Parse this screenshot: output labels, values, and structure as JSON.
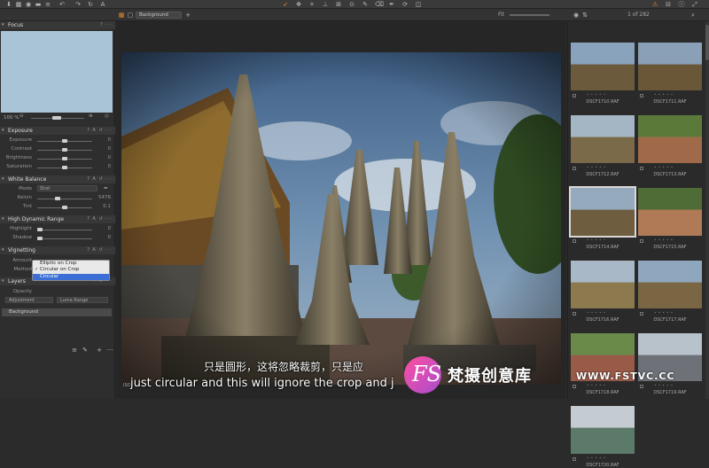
{
  "toolbar": {
    "left_icons": [
      "import-icon",
      "grid-icon",
      "camera-icon",
      "folder-icon",
      "undo-icon",
      "redo-icon",
      "redo-icon",
      "text-icon"
    ],
    "center_icons": [
      "cursor-icon",
      "move-icon",
      "crop-icon",
      "straighten-icon",
      "keystone-icon",
      "spot-icon",
      "brush-icon",
      "eraser-icon",
      "picker-icon",
      "rotate-icon",
      "gradient-icon"
    ],
    "right_icons": [
      "warning-icon",
      "compare-icon",
      "info-icon",
      "expand-icon"
    ]
  },
  "subbar": {
    "layer_select": "Background",
    "fit_label": "Fit",
    "counter": "1 of 282"
  },
  "left": {
    "focus": {
      "title": "Focus"
    },
    "zoom": {
      "value": "100 %"
    },
    "exposure": {
      "title": "Exposure",
      "rows": [
        {
          "label": "Exposure",
          "value": "0",
          "level": 0.5
        },
        {
          "label": "Contrast",
          "value": "0",
          "level": 0.5
        },
        {
          "label": "Brightness",
          "value": "0",
          "level": 0.5
        },
        {
          "label": "Saturation",
          "value": "0",
          "level": 0.5
        }
      ]
    },
    "white_balance": {
      "title": "White Balance",
      "mode_label": "Mode",
      "mode_value": "Shot",
      "rows": [
        {
          "label": "Kelvin",
          "value": "5476",
          "level": 0.35
        },
        {
          "label": "Tint",
          "value": "0.1",
          "level": 0.5
        }
      ]
    },
    "hdr": {
      "title": "High Dynamic Range",
      "rows": [
        {
          "label": "Highlight",
          "value": "0",
          "level": 0.0
        },
        {
          "label": "Shadow",
          "value": "0",
          "level": 0.0
        }
      ]
    },
    "vignetting": {
      "title": "Vignetting",
      "amount_label": "Amount",
      "method_label": "Method",
      "method_options": [
        "Elliptic on Crop",
        "Circular on Crop",
        "Circular"
      ],
      "selected_option": "Circular",
      "checked_option": "Circular on Crop"
    },
    "layers": {
      "title": "Layers",
      "opacity_label": "Opacity",
      "buttons": [
        "Adjustment",
        "Luma Range"
      ],
      "background_layer": "Background"
    }
  },
  "viewer": {
    "photo_label": "ISO"
  },
  "subtitles": {
    "chinese": "只是圆形，这将忽略裁剪，只是应",
    "english": "just circular and this will ignore the crop and j"
  },
  "watermark": {
    "logo_text": "FS",
    "chinese": "梵摄创意库",
    "url": "WWW.FSTVC.CC"
  },
  "browser": {
    "thumbs": [
      {
        "name": "DSCF1710.RAF",
        "selected": false
      },
      {
        "name": "DSCF1711.RAF",
        "selected": false
      },
      {
        "name": "DSCF1712.RAF",
        "selected": false
      },
      {
        "name": "DSCF1713.RAF",
        "selected": false
      },
      {
        "name": "DSCF1714.RAF",
        "selected": true
      },
      {
        "name": "DSCF1715.RAF",
        "selected": false
      },
      {
        "name": "DSCF1716.RAF",
        "selected": false
      },
      {
        "name": "DSCF1717.RAF",
        "selected": false
      },
      {
        "name": "DSCF1718.RAF",
        "selected": false
      },
      {
        "name": "DSCF1719.RAF",
        "selected": false
      },
      {
        "name": "DSCF1720.RAF",
        "selected": false
      }
    ]
  },
  "colors": {
    "accent": "#e7892b",
    "selection": "#3b6fd6",
    "panel": "#2e2e2e"
  }
}
